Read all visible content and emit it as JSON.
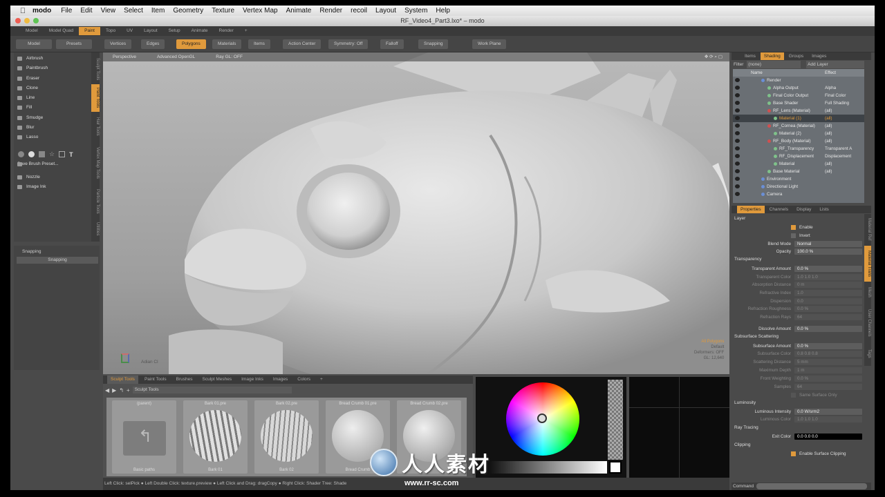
{
  "mac_menu": {
    "app_name": "modo",
    "items": [
      "File",
      "Edit",
      "View",
      "Select",
      "Item",
      "Geometry",
      "Texture",
      "Vertex Map",
      "Animate",
      "Render",
      "recoil",
      "Layout",
      "System",
      "Help"
    ]
  },
  "window": {
    "title": "RF_Video4_Part3.lxo* – modo"
  },
  "layout_tabs": [
    "Model",
    "Model Quad",
    "Paint",
    "Topo",
    "UV",
    "Layout",
    "Setup",
    "Animate",
    "Render"
  ],
  "layout_tabs_active": "Paint",
  "toolbar": {
    "model": "Model",
    "presets": "Presets",
    "vertices": "Vertices",
    "edges": "Edges",
    "polygons": "Polygons",
    "materials": "Materials",
    "items": "Items",
    "action_center": "Action Center",
    "symmetry": "Symmetry: Off",
    "falloff": "Falloff",
    "snapping": "Snapping",
    "work_plane": "Work Plane"
  },
  "left_tools": [
    "Airbrush",
    "Paintbrush",
    "Eraser",
    "Clone",
    "Line",
    "Fill",
    "Smudge",
    "Blur",
    "Lasso"
  ],
  "save_brush_preset": "Save Brush Preset...",
  "left_tools2": [
    "Nozzle",
    "Image Ink"
  ],
  "vertical_tabs": [
    "Sculpt Tools",
    "Paint Tools",
    "Hair Tools",
    "Vertex Map Tools",
    "Particle Tools",
    "Utilities"
  ],
  "snapping_section": {
    "title": "Snapping",
    "button": "Snapping"
  },
  "viewport": {
    "perspective": "Perspective",
    "shading": "Advanced OpenGL",
    "raygl": "Ray GL: OFF",
    "info": [
      "All Polygons",
      "Default",
      "Deformers: OFF",
      "GL: 12,640"
    ],
    "axis_label": "Adian Cl"
  },
  "bottom_tabs": [
    "Sculpt Tools",
    "Paint Tools",
    "Brushes",
    "Sculpt Meshes",
    "Image Inks",
    "Images",
    "Colors"
  ],
  "bottom_tabs_active": "Sculpt Tools",
  "preset_path": "Sculpt Tools",
  "presets": [
    {
      "top": "(parent)",
      "bottom": "Basic paths"
    },
    {
      "top": "Bark 01.pre",
      "bottom": "Bark 01"
    },
    {
      "top": "Bark 02.pre",
      "bottom": "Bark 02"
    },
    {
      "top": "Bread Crumb 01.pre",
      "bottom": "Bread Crumb"
    },
    {
      "top": "Bread Crumb 02.pre",
      "bottom": ""
    }
  ],
  "statusbar": "Left Click: selPick ● Left Double Click: texture.preview ● Left Click and Drag: dragCopy ● Right Click: Shader Tree: Shade",
  "shader_tabs": [
    "Items",
    "Shading",
    "Groups",
    "Images"
  ],
  "shader_tabs_active": "Shading",
  "filter": {
    "label": "Filter",
    "value": "(none)",
    "add_layer": "Add Layer"
  },
  "tree_header": {
    "name": "Name",
    "effect": "Effect"
  },
  "tree": [
    {
      "name": "Render",
      "effect": "",
      "indent": 1
    },
    {
      "name": "Alpha Output",
      "effect": "Alpha",
      "indent": 2
    },
    {
      "name": "Final Color Output",
      "effect": "Final Color",
      "indent": 2
    },
    {
      "name": "Base Shader",
      "effect": "Full Shading",
      "indent": 2
    },
    {
      "name": "RF_Lens (Material)",
      "effect": "(all)",
      "indent": 2
    },
    {
      "name": "Material (1)",
      "effect": "(all)",
      "indent": 3,
      "selected": true
    },
    {
      "name": "RF_Cornea (Material)",
      "effect": "(all)",
      "indent": 2
    },
    {
      "name": "Material (2)",
      "effect": "(all)",
      "indent": 3
    },
    {
      "name": "RF_Body (Material)",
      "effect": "(all)",
      "indent": 2
    },
    {
      "name": "RF_Transparency",
      "effect": "Transparent A",
      "indent": 3
    },
    {
      "name": "RF_Displacement",
      "effect": "Displacement",
      "indent": 3
    },
    {
      "name": "Material",
      "effect": "(all)",
      "indent": 3
    },
    {
      "name": "Base Material",
      "effect": "(all)",
      "indent": 2
    },
    {
      "name": "Environment",
      "effect": "",
      "indent": 1
    },
    {
      "name": "Directional Light",
      "effect": "",
      "indent": 1
    },
    {
      "name": "Camera",
      "effect": "",
      "indent": 1
    }
  ],
  "prop_tabs": [
    "Properties",
    "Channels",
    "Display",
    "Lists"
  ],
  "prop_tabs_active": "Properties",
  "properties": {
    "layer": "Layer",
    "enable": "Enable",
    "invert": "Invert",
    "blend_mode": {
      "k": "Blend Mode",
      "v": "Normal"
    },
    "opacity": {
      "k": "Opacity",
      "v": "100.0 %"
    },
    "transparency": "Transparency",
    "transparent_amount": {
      "k": "Transparent Amount",
      "v": "0.0 %"
    },
    "transparent_color": {
      "k": "Transparent Color",
      "v": "1.0   1.0   1.0"
    },
    "absorption_distance": {
      "k": "Absorption Distance",
      "v": "0 m"
    },
    "refractive_index": {
      "k": "Refractive Index",
      "v": "1.0"
    },
    "dispersion": {
      "k": "Dispersion",
      "v": "0.0"
    },
    "refraction_roughness": {
      "k": "Refraction Roughness",
      "v": "0.0 %"
    },
    "refraction_rays": {
      "k": "Refraction Rays",
      "v": "64"
    },
    "dissolve_amount": {
      "k": "Dissolve Amount",
      "v": "0.0 %"
    },
    "subsurface": "Subsurface Scattering",
    "subsurface_amount": {
      "k": "Subsurface Amount",
      "v": "0.0 %"
    },
    "subsurface_color": {
      "k": "Subsurface Color",
      "v": "0.8   0.8   0.8"
    },
    "scattering_distance": {
      "k": "Scattering Distance",
      "v": "5 mm"
    },
    "maximum_depth": {
      "k": "Maximum Depth",
      "v": "1 m"
    },
    "front_weighting": {
      "k": "Front Weighting",
      "v": "0.0 %"
    },
    "samples": {
      "k": "Samples",
      "v": "64"
    },
    "same_surface_only": "Same Surface Only",
    "luminosity": "Luminosity",
    "luminous_intensity": {
      "k": "Luminous Intensity",
      "v": "0.0 W/srm2"
    },
    "luminous_color": {
      "k": "Luminous Color",
      "v": "1.0   1.0   1.0"
    },
    "ray_tracing": "Ray Tracing",
    "exit_color": {
      "k": "Exit Color",
      "v": "0.0   0.0   0.0"
    },
    "clipping": "Clipping",
    "enable_surface_clipping": "Enable Surface Clipping"
  },
  "right_vtabs": [
    "Material Ref",
    "Material Trans",
    "Mesh",
    "User Channels",
    "Tags"
  ],
  "command_label": "Command",
  "watermark": {
    "text": "人人素材",
    "url": "www.rr-sc.com"
  },
  "colors": {
    "accent": "#e09a3c",
    "tree_bg": "#6a6f74"
  }
}
